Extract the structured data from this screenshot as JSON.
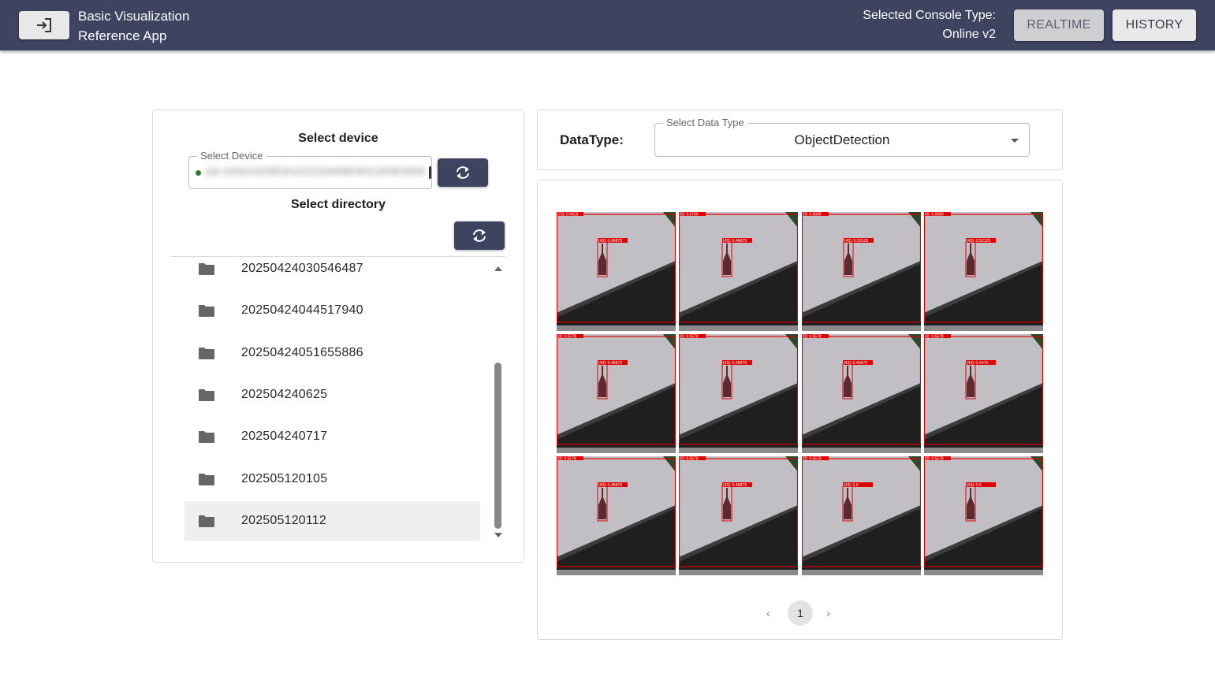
{
  "header": {
    "title_line1": "Basic Visualization",
    "title_line2": "Reference App",
    "console_label": "Selected Console Type:",
    "console_value": "Online v2",
    "realtime_label": "REALTIME",
    "history_label": "HISTORY"
  },
  "device": {
    "title": "Select device",
    "field_label": "Select Device",
    "value": "sid-1002A320E0A2011D44080401200E0000"
  },
  "directory": {
    "title": "Select directory",
    "items": [
      {
        "label": "20250424030546487"
      },
      {
        "label": "20250424044517940"
      },
      {
        "label": "20250424051655886"
      },
      {
        "label": "202504240625"
      },
      {
        "label": "202504240717"
      },
      {
        "label": "202505120105"
      },
      {
        "label": "202505120112"
      }
    ],
    "selected_index": 6
  },
  "data_type": {
    "label": "DataType:",
    "select_label": "Select Data Type",
    "value": "ObjectDetection"
  },
  "images": [
    {
      "corner": "[72]: 0.9625",
      "tag": "[43]: 0.46875"
    },
    {
      "corner": "[0]: 0.6789",
      "tag": "[43]: 0.46875"
    },
    {
      "corner": "[0]: 0.6689",
      "tag": "[43]: 0.53125"
    },
    {
      "corner": "[0]: 0.6689",
      "tag": "[43]: 0.53125"
    },
    {
      "corner": "[0]: 0.5578",
      "tag": "[43]: 0.46875"
    },
    {
      "corner": "[0]: 0.5578",
      "tag": "[43]: 0.46875"
    },
    {
      "corner": "[0]: 0.5578",
      "tag": "[43]: 0.46875"
    },
    {
      "corner": "[0]: 0.5578",
      "tag": "[43]: 0.4375"
    },
    {
      "corner": "[0]: 0.5578",
      "tag": "[43]: 0.46875"
    },
    {
      "corner": "[0]: 0.5578",
      "tag": "[43]: 0.46875"
    },
    {
      "corner": "[0]: 0.5578",
      "tag": "[43]: 0.5"
    },
    {
      "corner": "[0]: 0.5578",
      "tag": "[43]: 0.5"
    }
  ],
  "pagination": {
    "prev": "‹",
    "current": "1",
    "next": "›"
  },
  "colors": {
    "header_bg": "#3e4360",
    "detection_box": "#e00000",
    "device_status": "#2e7d32"
  }
}
